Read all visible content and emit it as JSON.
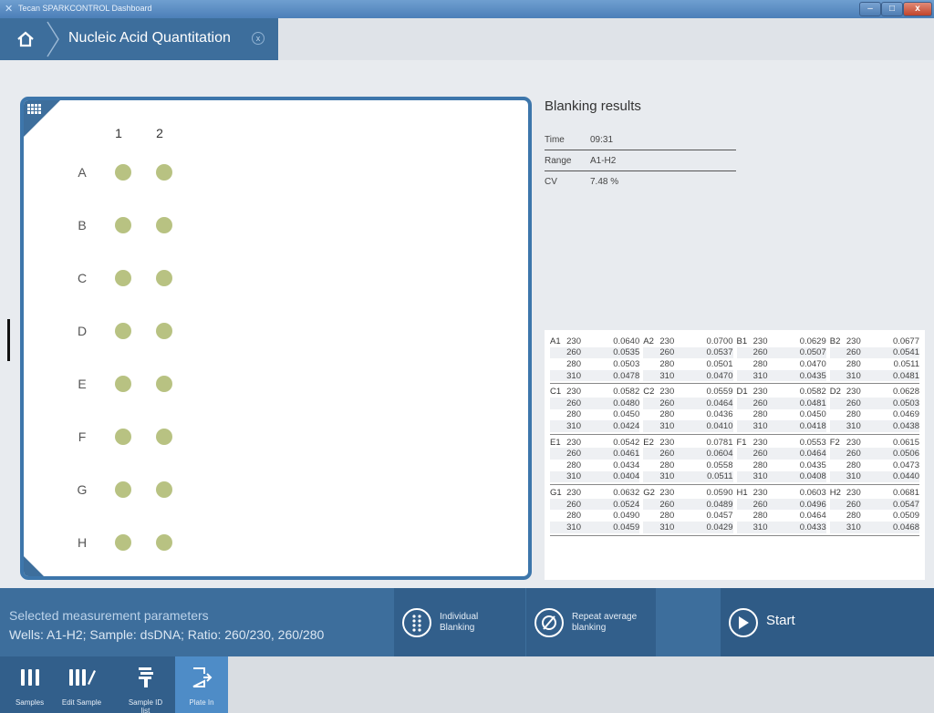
{
  "window": {
    "title": "Tecan SPARKCONTROL Dashboard",
    "min": "–",
    "max": "□",
    "close": "x"
  },
  "header": {
    "page_title": "Nucleic Acid Quantitation",
    "close_glyph": "x"
  },
  "plate": {
    "columns": [
      "1",
      "2"
    ],
    "rows": [
      "A",
      "B",
      "C",
      "D",
      "E",
      "F",
      "G",
      "H"
    ],
    "well_color": "#b8c282"
  },
  "results": {
    "title": "Blanking results",
    "time_label": "Time",
    "time_value": "09:31",
    "range_label": "Range",
    "range_value": "A1-H2",
    "cv_label": "CV",
    "cv_value": "7.48 %"
  },
  "table": [
    [
      {
        "well": "A1",
        "rows": [
          [
            "230",
            "0.0640"
          ],
          [
            "260",
            "0.0535"
          ],
          [
            "280",
            "0.0503"
          ],
          [
            "310",
            "0.0478"
          ]
        ]
      },
      {
        "well": "A2",
        "rows": [
          [
            "230",
            "0.0700"
          ],
          [
            "260",
            "0.0537"
          ],
          [
            "280",
            "0.0501"
          ],
          [
            "310",
            "0.0470"
          ]
        ]
      },
      {
        "well": "B1",
        "rows": [
          [
            "230",
            "0.0629"
          ],
          [
            "260",
            "0.0507"
          ],
          [
            "280",
            "0.0470"
          ],
          [
            "310",
            "0.0435"
          ]
        ]
      },
      {
        "well": "B2",
        "rows": [
          [
            "230",
            "0.0677"
          ],
          [
            "260",
            "0.0541"
          ],
          [
            "280",
            "0.0511"
          ],
          [
            "310",
            "0.0481"
          ]
        ]
      }
    ],
    [
      {
        "well": "C1",
        "rows": [
          [
            "230",
            "0.0582"
          ],
          [
            "260",
            "0.0480"
          ],
          [
            "280",
            "0.0450"
          ],
          [
            "310",
            "0.0424"
          ]
        ]
      },
      {
        "well": "C2",
        "rows": [
          [
            "230",
            "0.0559"
          ],
          [
            "260",
            "0.0464"
          ],
          [
            "280",
            "0.0436"
          ],
          [
            "310",
            "0.0410"
          ]
        ]
      },
      {
        "well": "D1",
        "rows": [
          [
            "230",
            "0.0582"
          ],
          [
            "260",
            "0.0481"
          ],
          [
            "280",
            "0.0450"
          ],
          [
            "310",
            "0.0418"
          ]
        ]
      },
      {
        "well": "D2",
        "rows": [
          [
            "230",
            "0.0628"
          ],
          [
            "260",
            "0.0503"
          ],
          [
            "280",
            "0.0469"
          ],
          [
            "310",
            "0.0438"
          ]
        ]
      }
    ],
    [
      {
        "well": "E1",
        "rows": [
          [
            "230",
            "0.0542"
          ],
          [
            "260",
            "0.0461"
          ],
          [
            "280",
            "0.0434"
          ],
          [
            "310",
            "0.0404"
          ]
        ]
      },
      {
        "well": "E2",
        "rows": [
          [
            "230",
            "0.0781"
          ],
          [
            "260",
            "0.0604"
          ],
          [
            "280",
            "0.0558"
          ],
          [
            "310",
            "0.0511"
          ]
        ]
      },
      {
        "well": "F1",
        "rows": [
          [
            "230",
            "0.0553"
          ],
          [
            "260",
            "0.0464"
          ],
          [
            "280",
            "0.0435"
          ],
          [
            "310",
            "0.0408"
          ]
        ]
      },
      {
        "well": "F2",
        "rows": [
          [
            "230",
            "0.0615"
          ],
          [
            "260",
            "0.0506"
          ],
          [
            "280",
            "0.0473"
          ],
          [
            "310",
            "0.0440"
          ]
        ]
      }
    ],
    [
      {
        "well": "G1",
        "rows": [
          [
            "230",
            "0.0632"
          ],
          [
            "260",
            "0.0524"
          ],
          [
            "280",
            "0.0490"
          ],
          [
            "310",
            "0.0459"
          ]
        ]
      },
      {
        "well": "G2",
        "rows": [
          [
            "230",
            "0.0590"
          ],
          [
            "260",
            "0.0489"
          ],
          [
            "280",
            "0.0457"
          ],
          [
            "310",
            "0.0429"
          ]
        ]
      },
      {
        "well": "H1",
        "rows": [
          [
            "230",
            "0.0603"
          ],
          [
            "260",
            "0.0496"
          ],
          [
            "280",
            "0.0464"
          ],
          [
            "310",
            "0.0433"
          ]
        ]
      },
      {
        "well": "H2",
        "rows": [
          [
            "230",
            "0.0681"
          ],
          [
            "260",
            "0.0547"
          ],
          [
            "280",
            "0.0509"
          ],
          [
            "310",
            "0.0468"
          ]
        ]
      }
    ]
  ],
  "params": {
    "label": "Selected measurement parameters",
    "value": "Wells: A1-H2; Sample: dsDNA; Ratio: 260/230, 260/280",
    "individual_blanking": "Individual Blanking",
    "repeat_average": "Repeat average blanking",
    "start": "Start"
  },
  "toolbar": {
    "samples": "Samples",
    "edit_sample": "Edit Sample",
    "sample_id": "Sample ID",
    "sample_id_sub": "list",
    "plate_in": "Plate In"
  },
  "colors": {
    "accent": "#3d6e9c",
    "plate_border": "#3d76ab",
    "well": "#b8c282",
    "active_tool": "#4e8cc7"
  },
  "icons": [
    "home-icon",
    "plate-grid-icon",
    "individual-blanking-icon",
    "repeat-blanking-icon",
    "start-play-icon",
    "samples-icon",
    "edit-sample-icon",
    "sample-id-icon",
    "plate-in-icon"
  ]
}
